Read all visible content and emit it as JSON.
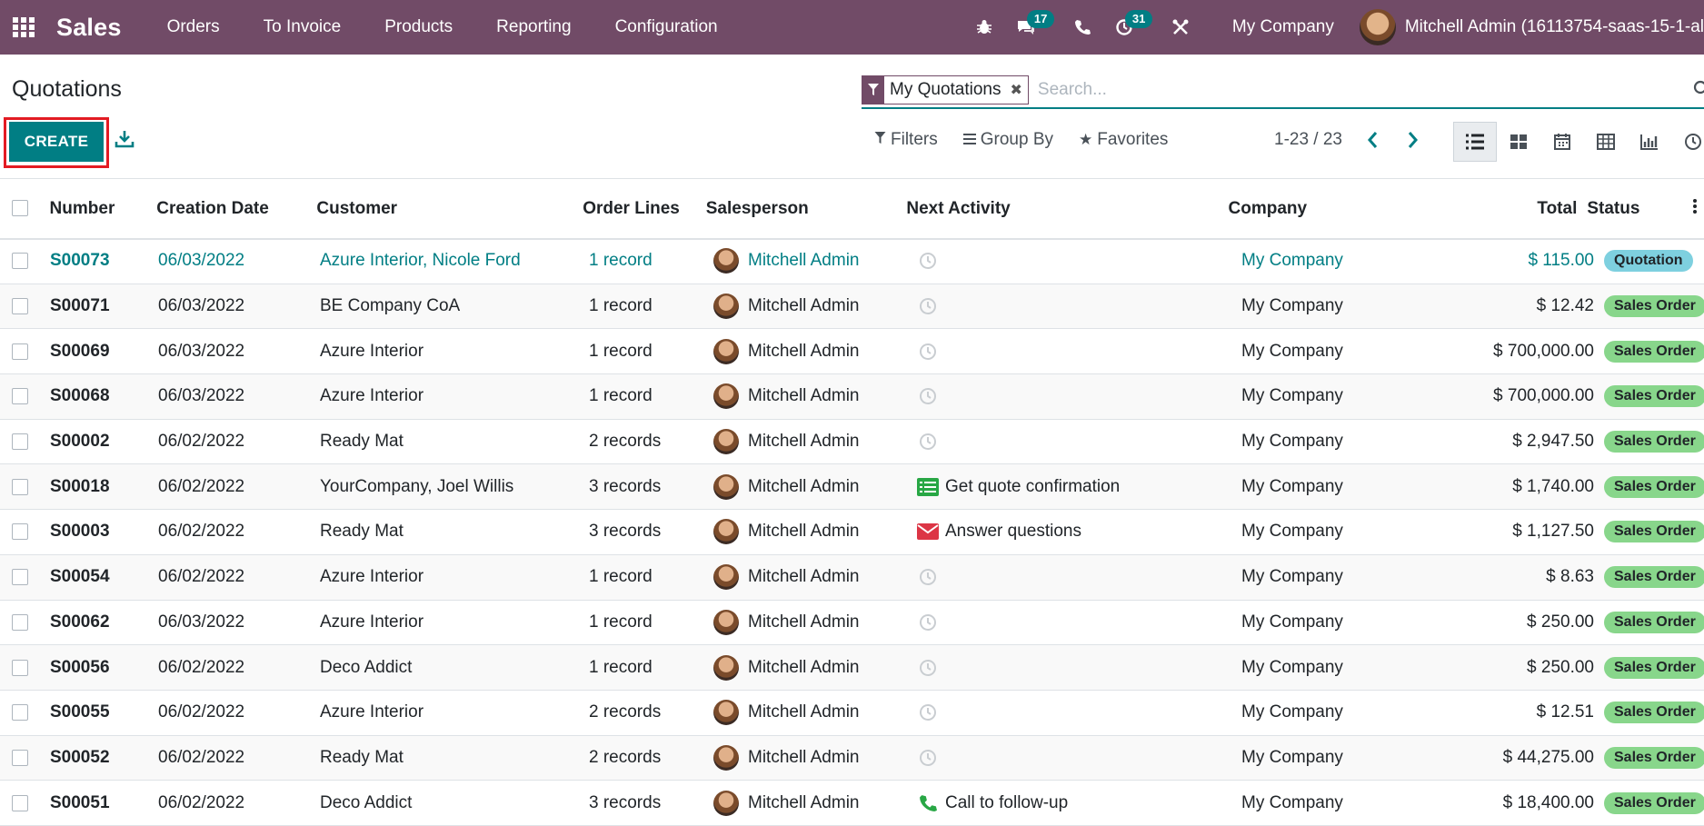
{
  "navbar": {
    "brand": "Sales",
    "menu": [
      "Orders",
      "To Invoice",
      "Products",
      "Reporting",
      "Configuration"
    ],
    "messages_count": "17",
    "activities_count": "31",
    "company": "My Company",
    "user": "Mitchell Admin (16113754-saas-15-1-al"
  },
  "control": {
    "title": "Quotations",
    "create_label": "CREATE",
    "facet_label": "My Quotations",
    "search_placeholder": "Search...",
    "filters_label": "Filters",
    "groupby_label": "Group By",
    "favorites_label": "Favorites",
    "pager": "1-23 / 23"
  },
  "columns": {
    "number": "Number",
    "date": "Creation Date",
    "customer": "Customer",
    "lines": "Order Lines",
    "salesperson": "Salesperson",
    "activity": "Next Activity",
    "company": "Company",
    "total": "Total",
    "status": "Status"
  },
  "rows": [
    {
      "number": "S00073",
      "date": "06/03/2022",
      "customer": "Azure Interior, Nicole Ford",
      "lines": "1 record",
      "salesperson": "Mitchell Admin",
      "activity": "",
      "activity_icon": "clock-icon",
      "company": "My Company",
      "total": "$ 115.00",
      "status": "Quotation"
    },
    {
      "number": "S00071",
      "date": "06/03/2022",
      "customer": "BE Company CoA",
      "lines": "1 record",
      "salesperson": "Mitchell Admin",
      "activity": "",
      "activity_icon": "clock-icon",
      "company": "My Company",
      "total": "$ 12.42",
      "status": "Sales Order"
    },
    {
      "number": "S00069",
      "date": "06/03/2022",
      "customer": "Azure Interior",
      "lines": "1 record",
      "salesperson": "Mitchell Admin",
      "activity": "",
      "activity_icon": "clock-icon",
      "company": "My Company",
      "total": "$ 700,000.00",
      "status": "Sales Order"
    },
    {
      "number": "S00068",
      "date": "06/03/2022",
      "customer": "Azure Interior",
      "lines": "1 record",
      "salesperson": "Mitchell Admin",
      "activity": "",
      "activity_icon": "clock-icon",
      "company": "My Company",
      "total": "$ 700,000.00",
      "status": "Sales Order"
    },
    {
      "number": "S00002",
      "date": "06/02/2022",
      "customer": "Ready Mat",
      "lines": "2 records",
      "salesperson": "Mitchell Admin",
      "activity": "",
      "activity_icon": "clock-icon",
      "company": "My Company",
      "total": "$ 2,947.50",
      "status": "Sales Order"
    },
    {
      "number": "S00018",
      "date": "06/02/2022",
      "customer": "YourCompany, Joel Willis",
      "lines": "3 records",
      "salesperson": "Mitchell Admin",
      "activity": "Get quote confirmation",
      "activity_icon": "todo-list-icon",
      "company": "My Company",
      "total": "$ 1,740.00",
      "status": "Sales Order"
    },
    {
      "number": "S00003",
      "date": "06/02/2022",
      "customer": "Ready Mat",
      "lines": "3 records",
      "salesperson": "Mitchell Admin",
      "activity": "Answer questions",
      "activity_icon": "envelope-icon",
      "company": "My Company",
      "total": "$ 1,127.50",
      "status": "Sales Order"
    },
    {
      "number": "S00054",
      "date": "06/02/2022",
      "customer": "Azure Interior",
      "lines": "1 record",
      "salesperson": "Mitchell Admin",
      "activity": "",
      "activity_icon": "clock-icon",
      "company": "My Company",
      "total": "$ 8.63",
      "status": "Sales Order"
    },
    {
      "number": "S00062",
      "date": "06/03/2022",
      "customer": "Azure Interior",
      "lines": "1 record",
      "salesperson": "Mitchell Admin",
      "activity": "",
      "activity_icon": "clock-icon",
      "company": "My Company",
      "total": "$ 250.00",
      "status": "Sales Order"
    },
    {
      "number": "S00056",
      "date": "06/02/2022",
      "customer": "Deco Addict",
      "lines": "1 record",
      "salesperson": "Mitchell Admin",
      "activity": "",
      "activity_icon": "clock-icon",
      "company": "My Company",
      "total": "$ 250.00",
      "status": "Sales Order"
    },
    {
      "number": "S00055",
      "date": "06/02/2022",
      "customer": "Azure Interior",
      "lines": "2 records",
      "salesperson": "Mitchell Admin",
      "activity": "",
      "activity_icon": "clock-icon",
      "company": "My Company",
      "total": "$ 12.51",
      "status": "Sales Order"
    },
    {
      "number": "S00052",
      "date": "06/02/2022",
      "customer": "Ready Mat",
      "lines": "2 records",
      "salesperson": "Mitchell Admin",
      "activity": "",
      "activity_icon": "clock-icon",
      "company": "My Company",
      "total": "$ 44,275.00",
      "status": "Sales Order"
    },
    {
      "number": "S00051",
      "date": "06/02/2022",
      "customer": "Deco Addict",
      "lines": "3 records",
      "salesperson": "Mitchell Admin",
      "activity": "Call to follow-up",
      "activity_icon": "phone-icon",
      "company": "My Company",
      "total": "$ 18,400.00",
      "status": "Sales Order"
    }
  ],
  "colors": {
    "navbar": "#714b67",
    "accent": "#017e84",
    "quotation_badge": "#7ed0df",
    "sales_order_badge": "#88d68b",
    "highlight_box": "#e31b23"
  }
}
